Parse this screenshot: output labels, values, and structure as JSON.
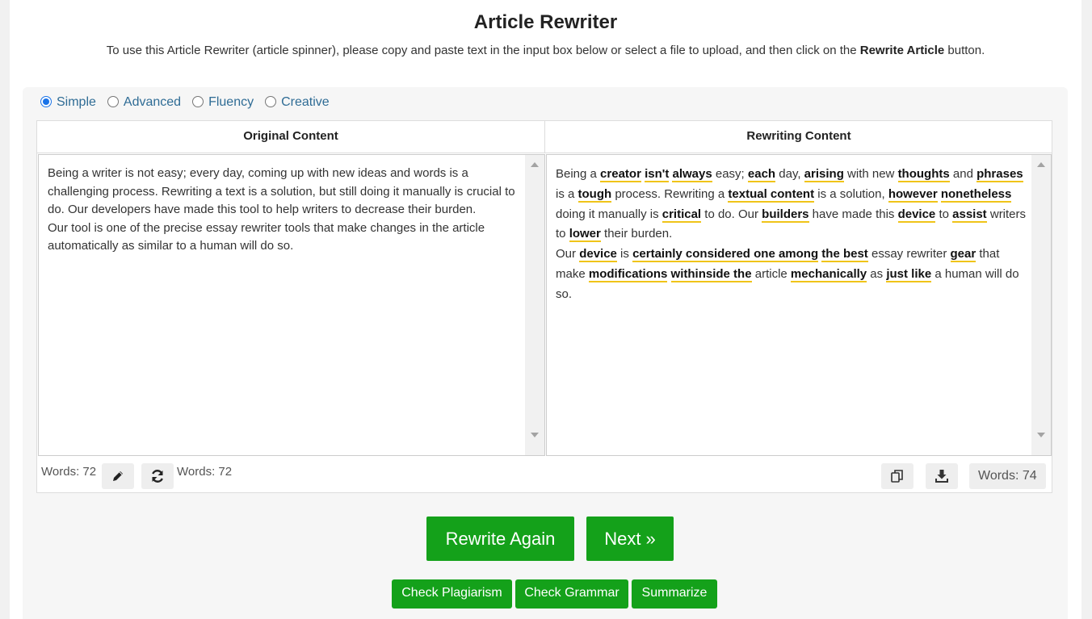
{
  "header": {
    "title": "Article Rewriter",
    "subtitle_prefix": "To use this Article Rewriter (article spinner), please copy and paste text in the input box below or select a file to upload, and then click on the ",
    "subtitle_bold": "Rewrite Article",
    "subtitle_suffix": " button."
  },
  "modes": {
    "selected": "Simple",
    "items": [
      "Simple",
      "Advanced",
      "Fluency",
      "Creative"
    ]
  },
  "editor": {
    "original_header": "Original Content",
    "rewriting_header": "Rewriting Content",
    "original_paragraphs": [
      "Being a writer is not easy; every day, coming up with new ideas and words is a challenging process. Rewriting a text is a solution, but still doing it manually is crucial to do. Our developers have made this tool to help writers to decrease their burden.",
      "Our tool is one of the precise essay rewriter tools that make changes in the article automatically as similar to a human will do so."
    ],
    "rewritten_paragraphs": [
      [
        {
          "t": "Being a "
        },
        {
          "t": "creator",
          "h": true
        },
        {
          "t": " "
        },
        {
          "t": "isn't",
          "h": true
        },
        {
          "t": " "
        },
        {
          "t": "always",
          "h": true
        },
        {
          "t": " easy; "
        },
        {
          "t": "each",
          "h": true
        },
        {
          "t": " day, "
        },
        {
          "t": "arising",
          "h": true
        },
        {
          "t": " with new "
        },
        {
          "t": "thoughts",
          "h": true
        },
        {
          "t": " and "
        },
        {
          "t": "phrases",
          "h": true
        },
        {
          "t": " is a "
        },
        {
          "t": "tough",
          "h": true
        },
        {
          "t": " process. Rewriting a "
        },
        {
          "t": "textual content",
          "h": true
        },
        {
          "t": " is a solution, "
        },
        {
          "t": "however",
          "h": true
        },
        {
          "t": " "
        },
        {
          "t": "nonetheless",
          "h": true
        },
        {
          "t": " doing it manually is "
        },
        {
          "t": "critical",
          "h": true
        },
        {
          "t": " to do. Our "
        },
        {
          "t": "builders",
          "h": true
        },
        {
          "t": " have made this "
        },
        {
          "t": "device",
          "h": true
        },
        {
          "t": " to "
        },
        {
          "t": "assist",
          "h": true
        },
        {
          "t": " writers to "
        },
        {
          "t": "lower",
          "h": true
        },
        {
          "t": " their burden."
        }
      ],
      [
        {
          "t": "Our "
        },
        {
          "t": "device",
          "h": true
        },
        {
          "t": " is "
        },
        {
          "t": "certainly considered one among",
          "h": true
        },
        {
          "t": " "
        },
        {
          "t": "the best",
          "h": true
        },
        {
          "t": " essay rewriter "
        },
        {
          "t": "gear",
          "h": true
        },
        {
          "t": " that make "
        },
        {
          "t": "modifications",
          "h": true
        },
        {
          "t": " "
        },
        {
          "t": "withinside the",
          "h": true
        },
        {
          "t": " article "
        },
        {
          "t": "mechanically",
          "h": true
        },
        {
          "t": " as "
        },
        {
          "t": "just like",
          "h": true
        },
        {
          "t": " a human will do so."
        }
      ]
    ],
    "words_original": "Words: 72",
    "words_middle": "Words: 72",
    "words_rewritten": "Words: 74"
  },
  "icons": {
    "edit": "pencil-icon",
    "refresh": "refresh-icon",
    "copy": "copy-icon",
    "download": "download-icon"
  },
  "actions": {
    "rewrite_again": "Rewrite Again",
    "next": "Next »",
    "check_plagiarism": "Check Plagiarism",
    "check_grammar": "Check Grammar",
    "summarize": "Summarize"
  },
  "colors": {
    "accent_green": "#14a11a",
    "highlight_underline": "#f0c419",
    "mode_label": "#2f6c95"
  }
}
